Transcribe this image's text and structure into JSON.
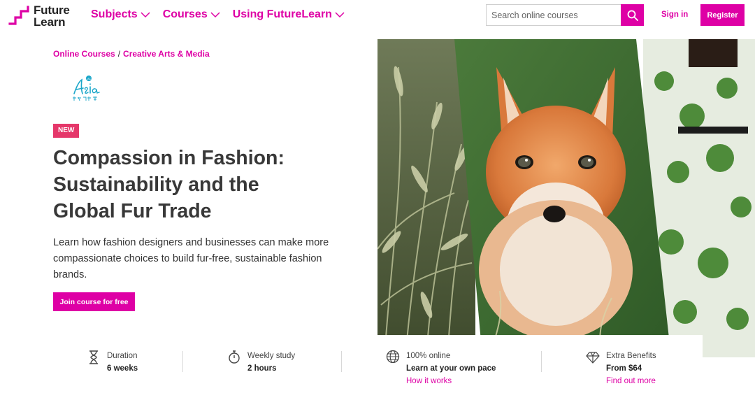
{
  "brand": {
    "logo_line1": "Future",
    "logo_line2": "Learn",
    "accent": "#de00a5"
  },
  "nav": [
    {
      "label": "Subjects",
      "icon": "chevron-down-icon"
    },
    {
      "label": "Courses",
      "icon": "chevron-down-icon"
    },
    {
      "label": "Using FutureLearn",
      "icon": "chevron-down-icon"
    }
  ],
  "search": {
    "placeholder": "Search online courses",
    "value": "",
    "icon": "search-icon"
  },
  "auth": {
    "signin_label": "Sign in",
    "register_label": "Register"
  },
  "breadcrumb": [
    "Online Courses",
    "Creative Arts & Media"
  ],
  "breadcrumb_separator": "/",
  "partner": {
    "name": "Act Asia",
    "icon": "partner-logo"
  },
  "course": {
    "badge": "NEW",
    "title": "Compassion in Fashion: Sustainability and the Global Fur Trade",
    "description": "Learn how fashion designers and businesses can make more compassionate choices to build fur-free, sustainable fashion brands.",
    "cta_label": "Join course for free"
  },
  "info": [
    {
      "icon": "hourglass-icon",
      "label": "Duration",
      "value": "6 weeks",
      "link": ""
    },
    {
      "icon": "stopwatch-icon",
      "label": "Weekly study",
      "value": "2 hours",
      "link": ""
    },
    {
      "icon": "globe-icon",
      "label": "100% online",
      "value": "Learn at your own pace",
      "link": "How it works"
    },
    {
      "icon": "diamond-icon",
      "label": "Extra Benefits",
      "value": "From $64",
      "link": "Find out more"
    }
  ]
}
